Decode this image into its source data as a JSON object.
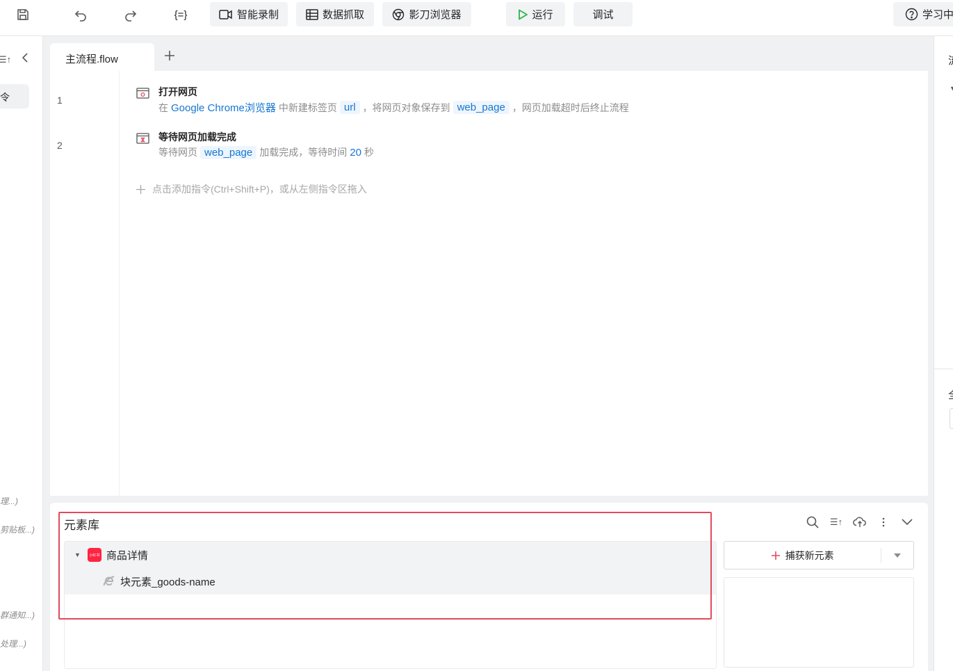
{
  "toolbar": {
    "record_label": "智能录制",
    "scrape_label": "数据抓取",
    "browser_label": "影刀浏览器",
    "run_label": "运行",
    "debug_label": "调试",
    "learn_label": "学习中"
  },
  "left_panel": {
    "partial_tab": "令",
    "hints": [
      "理...)",
      "剪贴板...)",
      "群通知...)",
      "处理...)"
    ]
  },
  "right_panel": {
    "partial_labels": [
      "流",
      "全"
    ]
  },
  "editor": {
    "tab_label": "主流程.flow",
    "steps": [
      {
        "line": "1",
        "title": "打开网页",
        "desc_1": "在",
        "browser": "Google Chrome浏览器",
        "desc_2": "中新建标签页",
        "var_1": "url",
        "desc_3": "，将网页对象保存到",
        "var_2": "web_page",
        "desc_4": "，网页加载超时后终止流程"
      },
      {
        "line": "2",
        "title": "等待网页加载完成",
        "desc_1": "等待网页",
        "var_1": "web_page",
        "desc_2": "加载完成，等待时间",
        "seconds": "20",
        "desc_3": "秒"
      }
    ],
    "add_hint": "点击添加指令(Ctrl+Shift+P)，或从左侧指令区拖入"
  },
  "element_library": {
    "title": "元素库",
    "group_badge": "小红书",
    "group_label": "商品详情",
    "element_label": "块元素_goods-name",
    "capture_label": "捕获新元素"
  },
  "colors": {
    "accent_blue": "#1677d2",
    "run_green": "#2bb54a",
    "highlight_red": "#e24a5c",
    "badge_red": "#ff2442"
  }
}
